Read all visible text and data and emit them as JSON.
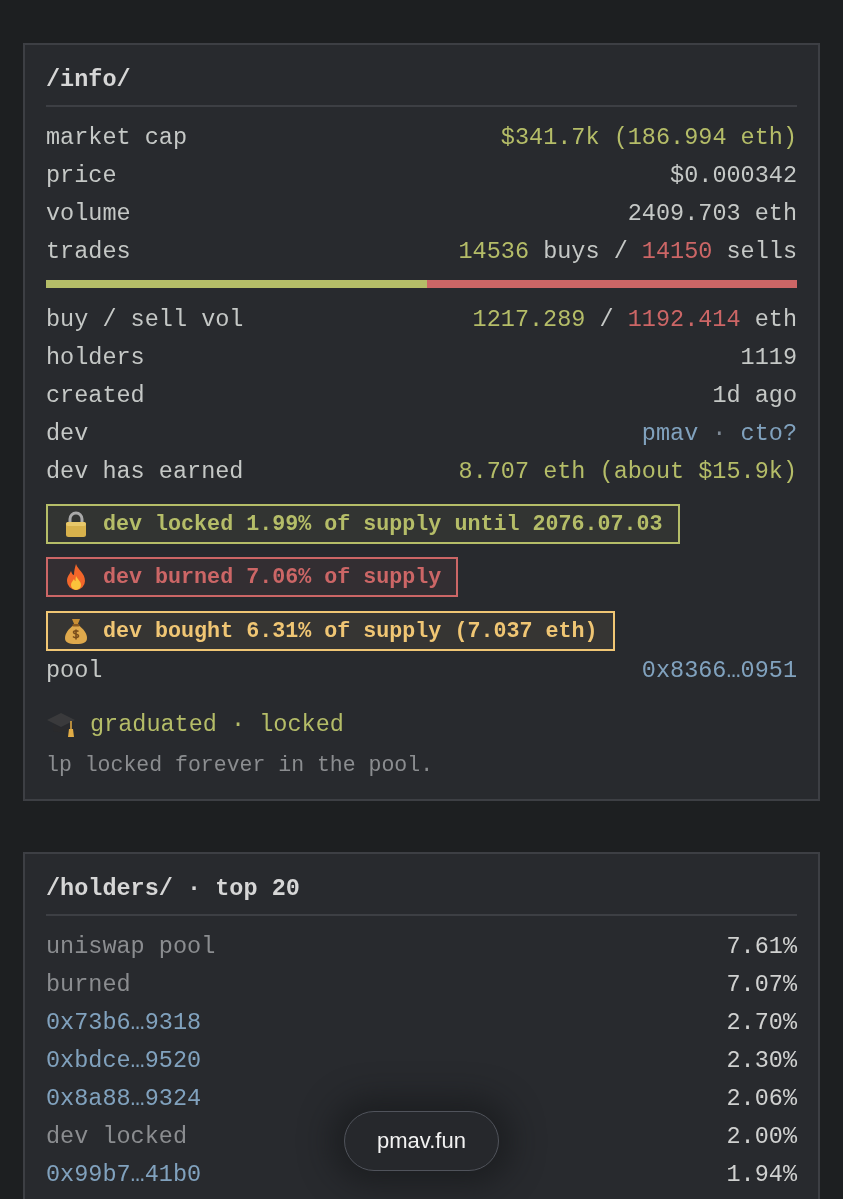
{
  "info": {
    "title": "/info/",
    "items": [
      {
        "kind": "row",
        "label": "market cap",
        "parts": [
          {
            "kind": "gain",
            "text": "$341.7k (186.994 eth)"
          }
        ]
      },
      {
        "kind": "row",
        "label": "price",
        "parts": [
          {
            "kind": "plain",
            "text": "$0.000342"
          }
        ]
      },
      {
        "kind": "row",
        "label": "volume",
        "parts": [
          {
            "kind": "plain",
            "text": "2409.703 eth"
          }
        ]
      },
      {
        "kind": "row",
        "label": "trades",
        "parts": [
          {
            "kind": "gain",
            "text": "14536"
          },
          {
            "kind": "plain",
            "text": " buys / "
          },
          {
            "kind": "loss",
            "text": "14150"
          },
          {
            "kind": "plain",
            "text": " sells"
          }
        ]
      },
      {
        "kind": "ratio_bar",
        "level": 0.507
      },
      {
        "kind": "row",
        "label": "buy / sell vol",
        "parts": [
          {
            "kind": "gain",
            "text": "1217.289"
          },
          {
            "kind": "plain",
            "text": " / "
          },
          {
            "kind": "loss",
            "text": "1192.414"
          },
          {
            "kind": "plain",
            "text": " eth"
          }
        ]
      },
      {
        "kind": "row",
        "label": "holders",
        "parts": [
          {
            "kind": "plain",
            "text": "1119"
          }
        ]
      },
      {
        "kind": "row",
        "label": "created",
        "parts": [
          {
            "kind": "plain",
            "text": "1d ago"
          }
        ]
      },
      {
        "kind": "link_row",
        "label": "dev",
        "separator": "·",
        "links": [
          "pmav",
          "cto?"
        ]
      },
      {
        "kind": "row",
        "label": "dev has earned",
        "parts": [
          {
            "kind": "gain",
            "text": "8.707 eth (about $15.9k)"
          }
        ]
      },
      {
        "kind": "lock_badge",
        "text": "dev locked 1.99% of supply until 2076.07.03"
      },
      {
        "kind": "burn_badge",
        "text": "dev burned 7.06% of supply"
      },
      {
        "kind": "buy_badge",
        "text": "dev bought 6.31% of supply (7.037 eth)"
      },
      {
        "kind": "link_row",
        "label": "pool",
        "links": [
          "0x8366…0951"
        ]
      },
      {
        "kind": "status",
        "text": "graduated · locked"
      },
      {
        "kind": "note",
        "text": "lp locked forever in the pool."
      }
    ]
  },
  "holders": {
    "title": "/holders/ · top 20",
    "rows": [
      {
        "kind": "label",
        "name": "uniswap pool",
        "share": "7.61%"
      },
      {
        "kind": "label",
        "name": "burned",
        "share": "7.07%"
      },
      {
        "kind": "address",
        "name": "0x73b6…9318",
        "share": "2.70%"
      },
      {
        "kind": "address",
        "name": "0xbdce…9520",
        "share": "2.30%"
      },
      {
        "kind": "address",
        "name": "0x8a88…9324",
        "share": "2.06%"
      },
      {
        "kind": "label",
        "name": "dev locked",
        "share": "2.00%"
      },
      {
        "kind": "address",
        "name": "0x99b7…41b0",
        "share": "1.94%"
      }
    ]
  },
  "browser_bar": {
    "url": "pmav.fun"
  }
}
